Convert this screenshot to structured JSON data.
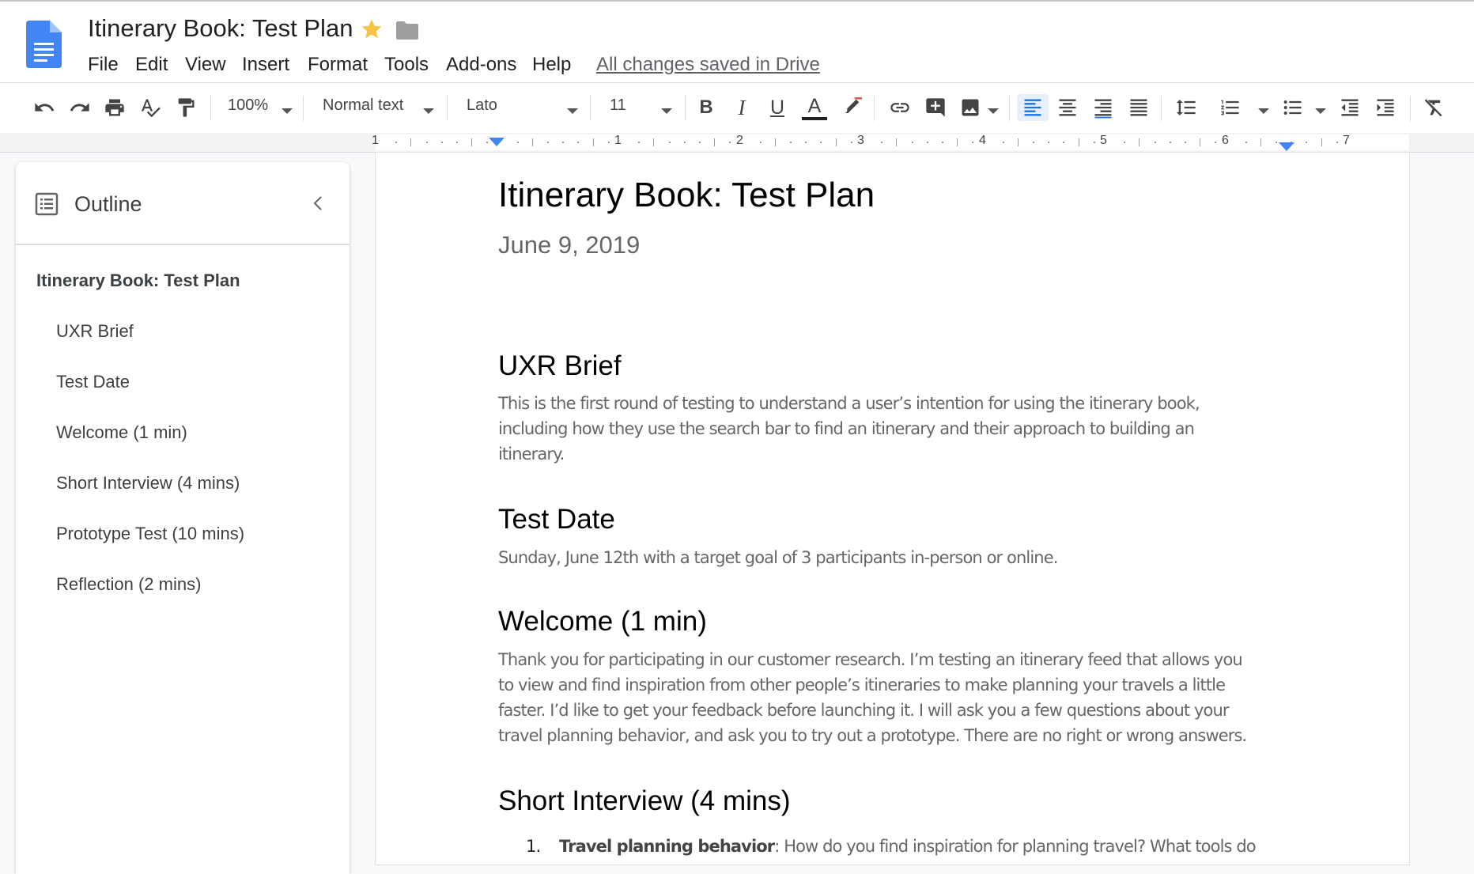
{
  "app": {
    "doc_title": "Itinerary Book: Test Plan",
    "menu": [
      "File",
      "Edit",
      "View",
      "Insert",
      "Format",
      "Tools",
      "Add-ons",
      "Help"
    ],
    "saved_status": "All changes saved in Drive"
  },
  "toolbar": {
    "zoom": "100%",
    "style": "Normal text",
    "font": "Lato",
    "font_size": "11",
    "icons": [
      "undo-icon",
      "redo-icon",
      "print-icon",
      "spellcheck-icon",
      "paint-format-icon",
      "bold-icon",
      "italic-icon",
      "underline-icon",
      "text-color-icon",
      "highlight-icon",
      "link-icon",
      "add-comment-icon",
      "insert-image-icon",
      "align-left-icon",
      "align-center-icon",
      "align-right-icon",
      "justify-icon",
      "line-spacing-icon",
      "numbered-list-icon",
      "bulleted-list-icon",
      "decrease-indent-icon",
      "increase-indent-icon",
      "clear-formatting-icon"
    ],
    "bold_label": "B",
    "italic_label": "I",
    "underline_label": "U",
    "text_color_label": "A",
    "accent_color": "#1a73e8"
  },
  "ruler": {
    "numbers": [
      "1",
      "1",
      "2",
      "3",
      "4",
      "5",
      "6",
      "7"
    ]
  },
  "outline": {
    "title": "Outline",
    "items": [
      {
        "label": "Itinerary Book: Test Plan",
        "level": 1
      },
      {
        "label": "UXR Brief",
        "level": 2
      },
      {
        "label": "Test Date",
        "level": 2
      },
      {
        "label": "Welcome (1 min)",
        "level": 2
      },
      {
        "label": "Short Interview (4 mins)",
        "level": 2
      },
      {
        "label": "Prototype Test (10 mins)",
        "level": 2
      },
      {
        "label": "Reflection (2 mins)",
        "level": 2
      }
    ]
  },
  "document": {
    "title": "Itinerary Book: Test Plan",
    "subtitle": "June 9, 2019",
    "sections": [
      {
        "heading": "UXR Brief",
        "lines": [
          "This is the first round of testing  to understand a user’s intention for using the itinerary book,",
          "including how they use the search bar to find an itinerary and their approach to building an",
          "itinerary."
        ]
      },
      {
        "heading": "Test Date",
        "lines": [
          "Sunday, June 12th with a target goal of 3 participants in-person or online."
        ]
      },
      {
        "heading": "Welcome (1 min)",
        "lines": [
          "Thank you for participating in our customer research. I’m testing an itinerary feed that allows you",
          "to view and find inspiration from other people’s itineraries to make planning your travels a little",
          "faster.  I’d like to get your feedback before launching it. I will ask you a few questions about your",
          "travel planning behavior, and ask you to try out a prototype. There are no right or wrong answers."
        ]
      },
      {
        "heading": "Short Interview (4 mins)",
        "list": [
          {
            "num": "1.",
            "bold": "Travel planning behavior",
            "text": ": How do you find inspiration for planning travel? What tools do"
          }
        ]
      }
    ]
  }
}
